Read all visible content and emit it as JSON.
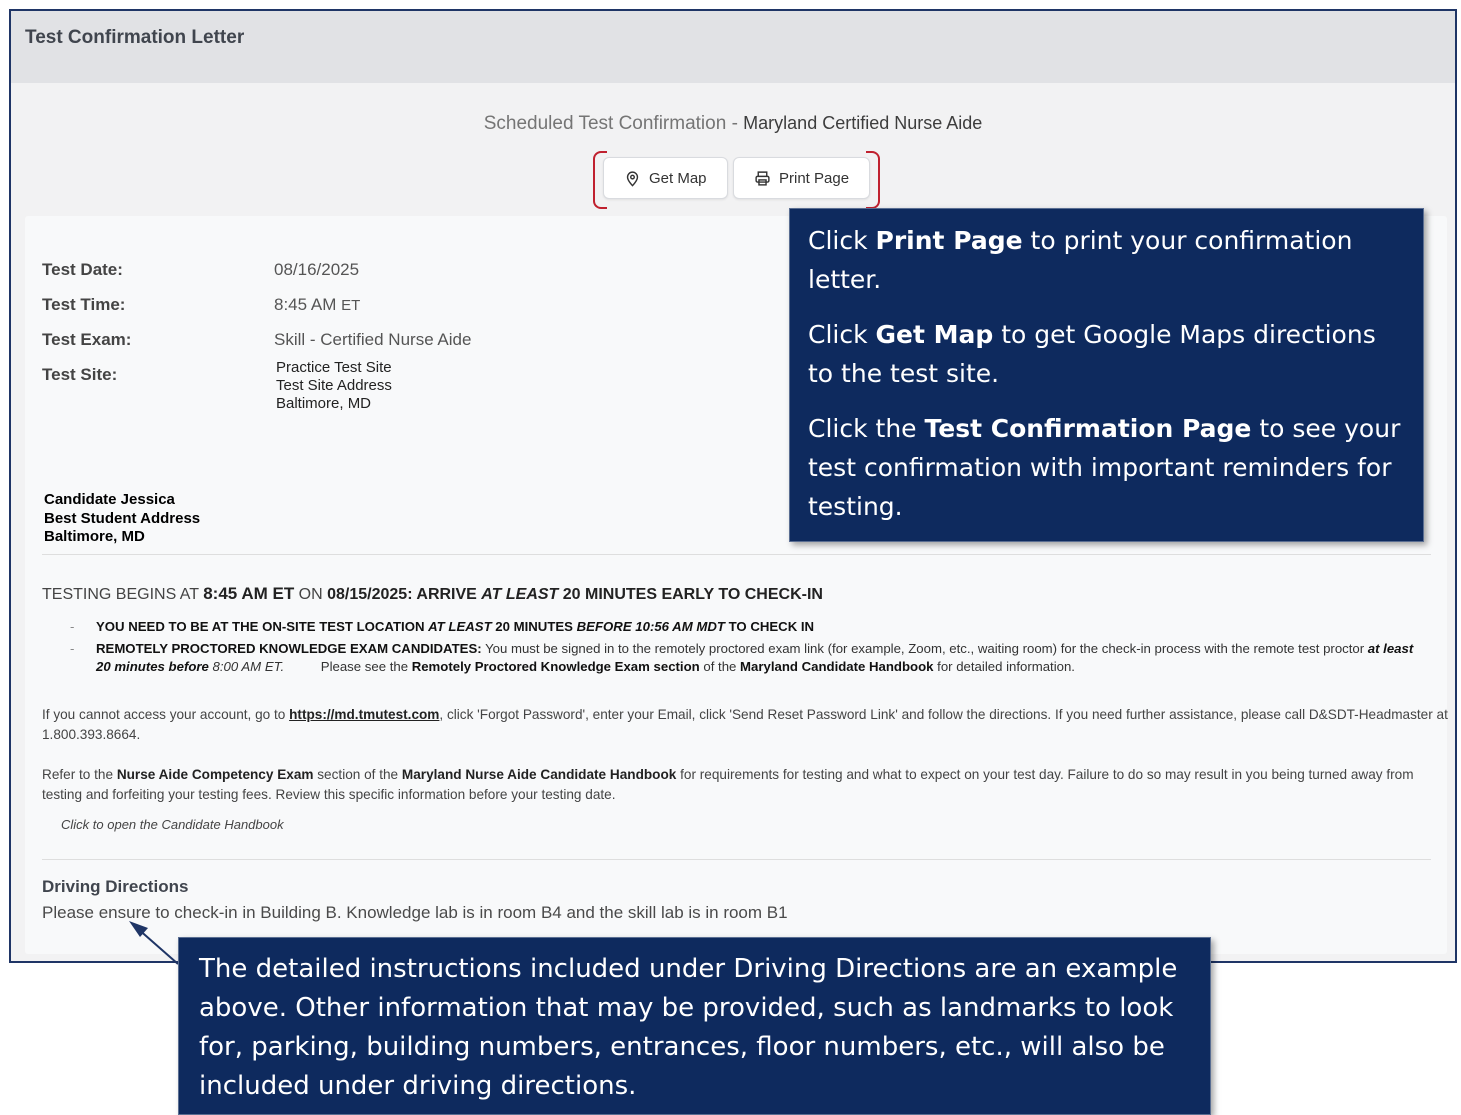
{
  "header": {
    "title": "Test Confirmation Letter"
  },
  "subtitle": {
    "prefix": "Scheduled Test Confirmation - ",
    "program": "Maryland Certified Nurse Aide"
  },
  "buttons": {
    "get_map": "Get Map",
    "print_page": "Print Page"
  },
  "details": {
    "test_date_label": "Test Date:",
    "test_date": "08/16/2025",
    "test_time_label": "Test Time:",
    "test_time": "8:45 AM",
    "test_time_zone": "ET",
    "test_exam_label": "Test Exam:",
    "test_exam": "Skill - Certified Nurse Aide",
    "test_site_label": "Test Site:",
    "test_site_lines": [
      "Practice Test Site",
      "Test Site Address",
      "Baltimore, MD"
    ]
  },
  "candidate": {
    "lines": [
      "Candidate Jessica",
      "Best Student Address",
      "Baltimore, MD"
    ]
  },
  "testing_begins": {
    "p1": "TESTING BEGINS AT ",
    "time": "8:45 AM ET",
    "p2": " ON ",
    "date": "08/15/2025:",
    "p3": "  ARRIVE ",
    "at_least": "AT LEAST",
    "p4": " 20 MINUTES EARLY TO CHECK-IN"
  },
  "bullets": {
    "b1": {
      "a": "YOU NEED TO BE AT THE ON-SITE TEST LOCATION ",
      "b": "AT LEAST",
      "c": " 20 MINUTES ",
      "d": "BEFORE 10:56 AM MDT",
      "e": " TO CHECK IN"
    },
    "b2": {
      "a": "REMOTELY PROCTORED KNOWLEDGE EXAM CANDIDATES:",
      "b": " You must be signed in to the remotely proctored exam link (for example, Zoom, etc., waiting room) for the check-in process with the remote test proctor ",
      "c": "at least 20 minutes before",
      "d": "  8:00 AM ET.",
      "e": "          Please see the ",
      "f": "Remotely Proctored Knowledge Exam section",
      "g": " of the ",
      "h": "Maryland Candidate Handbook",
      "i": " for detailed information."
    }
  },
  "account_para": {
    "a": "If you cannot access your account, go to ",
    "link": "https://md.tmutest.com",
    "b": ", click 'Forgot Password', enter your Email, click 'Send Reset Password Link' and follow the directions.  If you need further assistance, please call D&SDT-Headmaster at 1.800.393.8664."
  },
  "refer_para": {
    "a": "Refer to the ",
    "b": "Nurse Aide Competency Exam",
    "c": " section of the ",
    "d": "Maryland Nurse Aide Candidate Handbook",
    "e": " for requirements for testing and what to expect on your test day.  Failure to do so may result in you being turned away from testing and forfeiting your testing fees.  Review this specific information before your testing date."
  },
  "handbook_link": "Click to open the Candidate Handbook",
  "driving": {
    "title": "Driving Directions",
    "text": "Please ensure to check-in in Building B. Knowledge lab is in room B4 and the skill lab is in room B1"
  },
  "callout_top": {
    "p1a": "Click ",
    "p1b": "Print Page",
    "p1c": " to print your confirmation letter.",
    "p2a": "Click ",
    "p2b": "Get Map",
    "p2c": " to get Google Maps directions to the test site.",
    "p3a": "Click the ",
    "p3b": "Test Confirmation Page",
    "p3c": " to see your test confirmation with important reminders for testing."
  },
  "callout_bottom": {
    "text": "The detailed instructions included under Driving Directions are an example above. Other information that may be provided, such as landmarks to look for, parking, building numbers, entrances, floor numbers, etc., will also be included under driving directions."
  },
  "colors": {
    "callout_bg": "#0e2a5e",
    "bracket": "#c0212f",
    "frame_border": "#1f3566"
  },
  "icons": {
    "get_map": "map-pin-icon",
    "print_page": "printer-icon"
  }
}
